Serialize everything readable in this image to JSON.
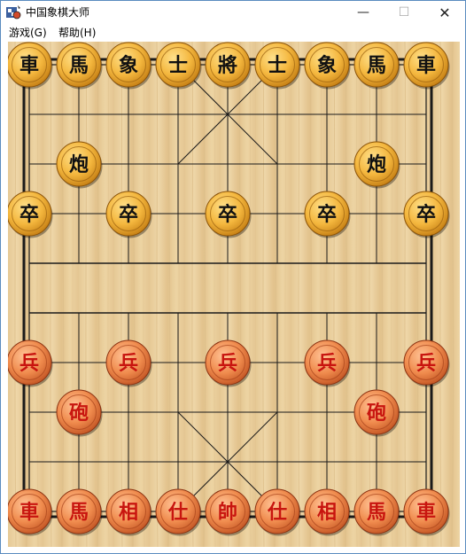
{
  "window": {
    "title": "中国象棋大师",
    "minimize_glyph": "—",
    "maximize_glyph": "☐",
    "close_glyph": "✕",
    "icon": "chess-app-icon"
  },
  "menu": {
    "items": [
      {
        "label": "游戏(G)"
      },
      {
        "label": "帮助(H)"
      }
    ]
  },
  "board": {
    "files": 9,
    "ranks": 10,
    "river_text": "",
    "colors": {
      "wood_light": "#e8cfa0",
      "wood_dark": "#d9b57c",
      "line": "#1a1a1a",
      "black_piece_face": "#f2b43c",
      "black_piece_text": "#111111",
      "red_piece_face": "#f08a4a",
      "red_piece_text": "#c8150f"
    },
    "pieces": [
      {
        "side": "black",
        "char": "車",
        "col": 0,
        "row": 0
      },
      {
        "side": "black",
        "char": "馬",
        "col": 1,
        "row": 0
      },
      {
        "side": "black",
        "char": "象",
        "col": 2,
        "row": 0
      },
      {
        "side": "black",
        "char": "士",
        "col": 3,
        "row": 0
      },
      {
        "side": "black",
        "char": "將",
        "col": 4,
        "row": 0
      },
      {
        "side": "black",
        "char": "士",
        "col": 5,
        "row": 0
      },
      {
        "side": "black",
        "char": "象",
        "col": 6,
        "row": 0
      },
      {
        "side": "black",
        "char": "馬",
        "col": 7,
        "row": 0
      },
      {
        "side": "black",
        "char": "車",
        "col": 8,
        "row": 0
      },
      {
        "side": "black",
        "char": "炮",
        "col": 1,
        "row": 2
      },
      {
        "side": "black",
        "char": "炮",
        "col": 7,
        "row": 2
      },
      {
        "side": "black",
        "char": "卒",
        "col": 0,
        "row": 3
      },
      {
        "side": "black",
        "char": "卒",
        "col": 2,
        "row": 3
      },
      {
        "side": "black",
        "char": "卒",
        "col": 4,
        "row": 3
      },
      {
        "side": "black",
        "char": "卒",
        "col": 6,
        "row": 3
      },
      {
        "side": "black",
        "char": "卒",
        "col": 8,
        "row": 3
      },
      {
        "side": "red",
        "char": "兵",
        "col": 0,
        "row": 6
      },
      {
        "side": "red",
        "char": "兵",
        "col": 2,
        "row": 6
      },
      {
        "side": "red",
        "char": "兵",
        "col": 4,
        "row": 6
      },
      {
        "side": "red",
        "char": "兵",
        "col": 6,
        "row": 6
      },
      {
        "side": "red",
        "char": "兵",
        "col": 8,
        "row": 6
      },
      {
        "side": "red",
        "char": "砲",
        "col": 1,
        "row": 7
      },
      {
        "side": "red",
        "char": "砲",
        "col": 7,
        "row": 7
      },
      {
        "side": "red",
        "char": "車",
        "col": 0,
        "row": 9
      },
      {
        "side": "red",
        "char": "馬",
        "col": 1,
        "row": 9
      },
      {
        "side": "red",
        "char": "相",
        "col": 2,
        "row": 9
      },
      {
        "side": "red",
        "char": "仕",
        "col": 3,
        "row": 9
      },
      {
        "side": "red",
        "char": "帥",
        "col": 4,
        "row": 9
      },
      {
        "side": "red",
        "char": "仕",
        "col": 5,
        "row": 9
      },
      {
        "side": "red",
        "char": "相",
        "col": 6,
        "row": 9
      },
      {
        "side": "red",
        "char": "馬",
        "col": 7,
        "row": 9
      },
      {
        "side": "red",
        "char": "車",
        "col": 8,
        "row": 9
      }
    ]
  }
}
